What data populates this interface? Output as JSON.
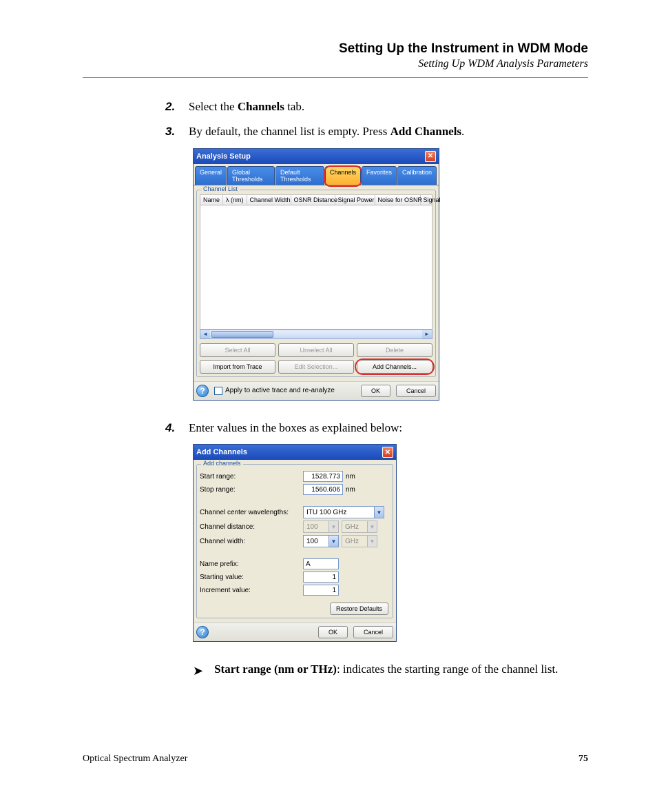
{
  "header": {
    "title": "Setting Up the Instrument in WDM Mode",
    "subtitle": "Setting Up WDM Analysis Parameters"
  },
  "steps": {
    "s2": {
      "num": "2.",
      "pre": "Select the ",
      "bold": "Channels",
      "post": " tab."
    },
    "s3": {
      "num": "3.",
      "pre": "By default, the channel list is empty. Press ",
      "bold": "Add Channels",
      "post": "."
    },
    "s4": {
      "num": "4.",
      "text": "Enter values in the boxes as explained below:"
    }
  },
  "dlg1": {
    "title": "Analysis Setup",
    "tabs": [
      "General",
      "Global Thresholds",
      "Default Thresholds",
      "Channels",
      "Favorites",
      "Calibration"
    ],
    "group_title": "Channel List",
    "columns": [
      "Name",
      "λ (nm)",
      "Channel Width",
      "OSNR Distance",
      "Signal Power",
      "Noise for OSNR",
      "Signal"
    ],
    "btns_row1": [
      "Select All",
      "Unselect All",
      "Delete"
    ],
    "btns_row2": [
      "Import from Trace",
      "Edit Selection...",
      "Add Channels..."
    ],
    "apply_label": "Apply to active trace and re-analyze",
    "ok": "OK",
    "cancel": "Cancel"
  },
  "dlg2": {
    "title": "Add Channels",
    "group_title": "Add channels",
    "start_range_label": "Start range:",
    "start_range_value": "1528.773",
    "stop_range_label": "Stop range:",
    "stop_range_value": "1560.606",
    "nm": "nm",
    "center_label": "Channel center wavelengths:",
    "center_value": "ITU 100 GHz",
    "distance_label": "Channel distance:",
    "distance_value": "100",
    "width_label": "Channel width:",
    "width_value": "100",
    "ghz": "GHz",
    "name_prefix_label": "Name prefix:",
    "name_prefix_value": "A",
    "starting_value_label": "Starting value:",
    "starting_value_value": "1",
    "increment_label": "Increment value:",
    "increment_value": "1",
    "restore": "Restore Defaults",
    "ok": "OK",
    "cancel": "Cancel"
  },
  "bullet": {
    "bold": "Start range (nm or THz)",
    "rest": ": indicates the starting range of the channel list."
  },
  "footer": {
    "product": "Optical Spectrum Analyzer",
    "page": "75"
  }
}
